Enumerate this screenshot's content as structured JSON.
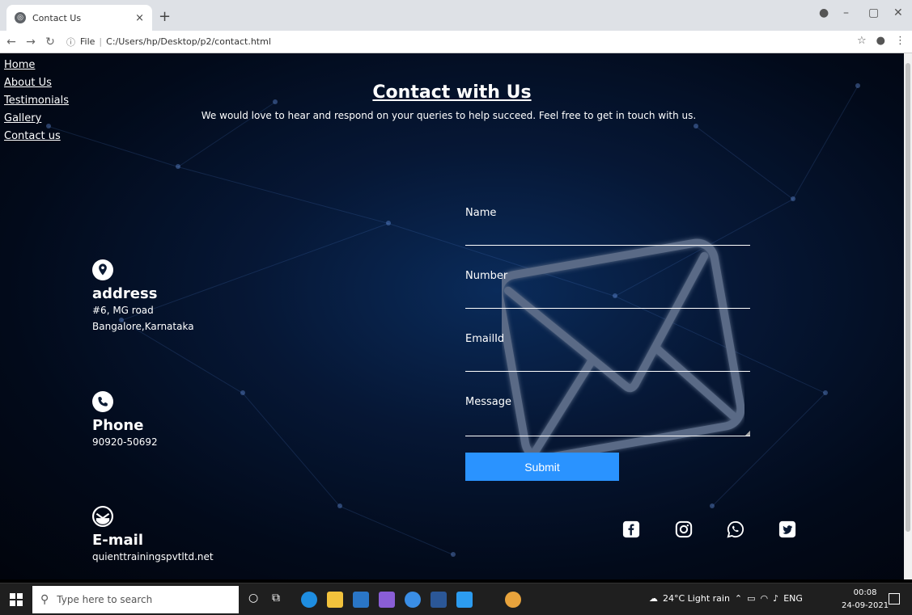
{
  "browser": {
    "tab_title": "Contact Us",
    "tab_close": "×",
    "new_tab": "+",
    "url_prefix": "File",
    "url": "C:/Users/hp/Desktop/p2/contact.html"
  },
  "nav": {
    "items": [
      "Home",
      "About Us",
      "Testimonials",
      "Gallery",
      "Contact us"
    ]
  },
  "page": {
    "title": "Contact with Us",
    "subtitle": "We would love to hear and respond on your queries to help succeed. Feel free to get in touch with us."
  },
  "contacts": {
    "address": {
      "heading": "address",
      "line1": "#6, MG road",
      "line2": "Bangalore,Karnataka",
      "icon": "location-pin-icon"
    },
    "phone": {
      "heading": "Phone",
      "line1": "90920-50692",
      "icon": "phone-icon"
    },
    "email": {
      "heading": "E-mail",
      "line1": "quienttrainingspvtltd.net",
      "icon": "mail-icon"
    }
  },
  "form": {
    "name_label": "Name",
    "number_label": "Number",
    "email_label": "EmailId",
    "message_label": "Message",
    "submit_label": "Submit",
    "submit_color": "#2a93ff"
  },
  "social": [
    "facebook-icon",
    "instagram-icon",
    "whatsapp-icon",
    "twitter-icon"
  ],
  "taskbar": {
    "search_placeholder": "Type here to search",
    "weather": "24°C  Light rain",
    "lang": "ENG",
    "time": "00:08",
    "date": "24-09-2021"
  }
}
